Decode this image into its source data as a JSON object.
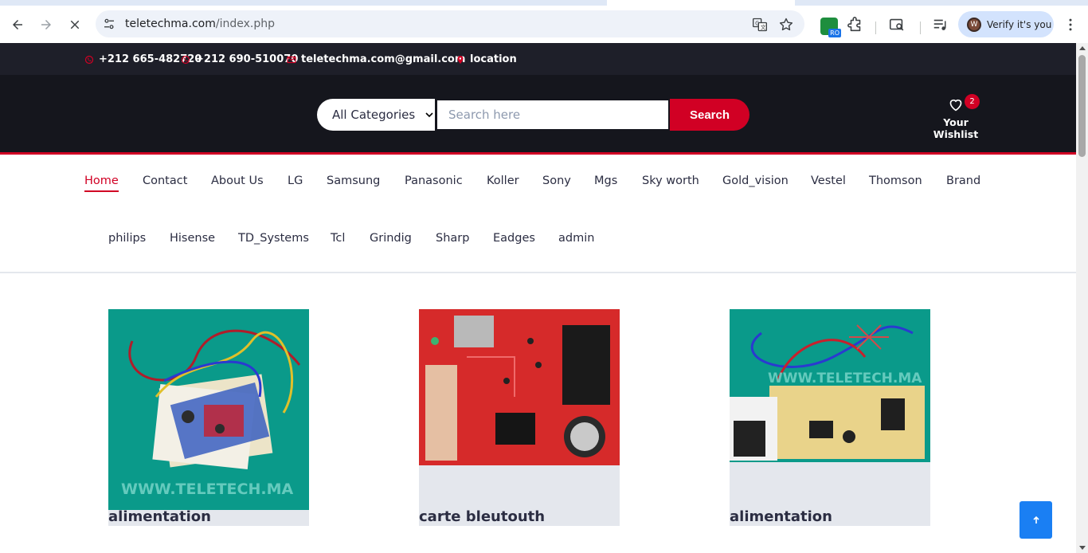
{
  "browser": {
    "url_host": "teletechma.com",
    "url_path": "/index.php",
    "profile_label": "Verify it's you",
    "profile_initial": "W",
    "extension_badge": "RO"
  },
  "top_header": {
    "phone_1": "+212 665-482720",
    "phone_2": "+212 690-510070",
    "email": "teletechma.com@gmail.com",
    "location": "location"
  },
  "header": {
    "category_selected": "All Categories",
    "search_placeholder": "Search here",
    "search_button": "Search",
    "wishlist_label": "Your Wishlist",
    "wishlist_count": "2"
  },
  "nav": {
    "row1": [
      "Home",
      "Contact",
      "About Us",
      "LG",
      "Samsung",
      "Panasonic",
      "Koller",
      "Sony",
      "Mgs",
      "Sky worth",
      "Gold_vision",
      "Vestel",
      "Thomson",
      "Brand"
    ],
    "row2": [
      "philips",
      "Hisense",
      "TD_Systems",
      "Tcl",
      "Grindig",
      "Sharp",
      "Eadges",
      "admin"
    ],
    "active": "Home"
  },
  "products": [
    {
      "name": "alimentation",
      "watermark": "WWW.TELETECH.MA"
    },
    {
      "name": "carte bleutouth"
    },
    {
      "name": "alimentation",
      "watermark": "WWW.TELETECH.MA"
    }
  ],
  "colors": {
    "accent": "#d10024",
    "header_dark": "#15161d",
    "top_header": "#1e1f29",
    "product_bg": "#e4e7ed",
    "teal_bg": "#0a9a8a",
    "back_to_top": "#1a7ff3"
  },
  "icons": {
    "phone": "whatsapp-icon",
    "email": "envelope-icon",
    "location": "map-marker-icon",
    "wishlist": "heart-icon",
    "back_to_top": "arrow-up-icon"
  }
}
